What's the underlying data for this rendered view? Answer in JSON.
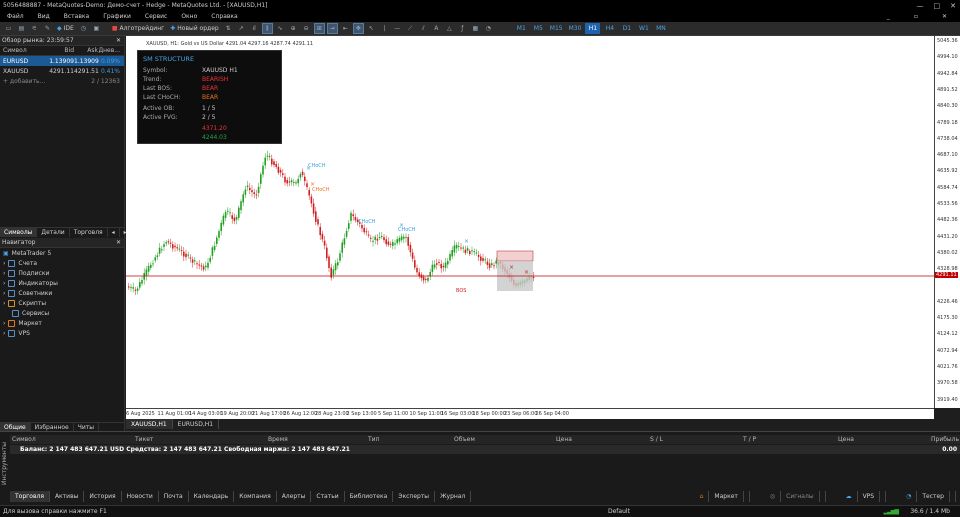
{
  "titlebar": {
    "text": "5056488887 - MetaQuotes-Demo: Демо-счет - Hedge - MetaQuotes Ltd. - [XAUUSD,H1]",
    "min": "—",
    "max": "□",
    "close": "✕"
  },
  "menu": [
    "Файл",
    "Вид",
    "Вставка",
    "Графики",
    "Сервис",
    "Окно",
    "Справка"
  ],
  "menu_right": [
    "_",
    "▫",
    "✕"
  ],
  "toolbar": {
    "ide": "IDE",
    "algo": "Алготрейдинг",
    "order": "Новый ордер",
    "timeframes": [
      "M1",
      "M5",
      "M15",
      "M30",
      "H1",
      "H4",
      "D1",
      "W1",
      "MN"
    ],
    "active_tf": "H1"
  },
  "market_watch": {
    "title": "Обзор рынка: 23:59:57",
    "headers": [
      "Символ",
      "Bid",
      "Ask",
      "Днев..."
    ],
    "rows": [
      {
        "symbol": "EURUSD",
        "bid": "1.13909",
        "ask": "1.13909",
        "chg": "0.09%"
      },
      {
        "symbol": "XAUUSD",
        "bid": "4291.11",
        "ask": "4291.51",
        "chg": "0.41%"
      }
    ],
    "add": "+ добавить...",
    "count": "2 / 12363",
    "tabs": [
      "Символы",
      "Детали",
      "Торговля"
    ]
  },
  "navigator": {
    "title": "Навигатор",
    "root": "MetaTrader 5",
    "items": [
      "Счета",
      "Подписки",
      "Индикаторы",
      "Советники",
      "Скрипты",
      "Сервисы",
      "Маркет",
      "VPS"
    ],
    "tabs": [
      "Общие",
      "Избранное",
      "Читы"
    ]
  },
  "chart": {
    "header": "XAUUSD, H1:  Gold vs US Dollar  4291.04 4297.16 4287.74 4291.11",
    "bg": "#ffffff",
    "bull": "#20a020",
    "bear": "#d02020",
    "labels": {
      "choch": "CHoCH",
      "bos": "BOS"
    }
  },
  "price_axis": [
    "5045.36",
    "4994.10",
    "4942.84",
    "4891.52",
    "4840.30",
    "4789.18",
    "4738.04",
    "4687.10",
    "4635.92",
    "4584.74",
    "4533.56",
    "4482.36",
    "4431.20",
    "4380.02",
    "4328.98",
    "4291.11",
    "4226.46",
    "4175.30",
    "4124.12",
    "4072.94",
    "4021.76",
    "3970.58",
    "3919.40"
  ],
  "current_price": "4291.11",
  "time_axis": [
    "6 Aug 2025",
    "11 Aug 01:00",
    "14 Aug 03:00",
    "19 Aug 20:00",
    "21 Aug 17:00",
    "26 Aug 12:00",
    "28 Aug 23:00",
    "2 Sep 13:00",
    "5 Sep 11:00",
    "10 Sep 11:00",
    "16 Sep 03:00",
    "18 Sep 00:00",
    "23 Sep 06:00",
    "26 Sep 04:00"
  ],
  "info_panel": {
    "title": "SM STRUCTURE",
    "rows": [
      {
        "k": "Symbol:",
        "v": "XAUUSD H1"
      },
      {
        "k": "Trend:",
        "v": "BEARISH"
      },
      {
        "k": "Last BOS:",
        "v": "BEAR"
      },
      {
        "k": "Last CHoCH:",
        "v": "BEAR"
      },
      {
        "k": "Active OB:",
        "v": "1 / 5"
      },
      {
        "k": "Active FVG:",
        "v": "2 / 5"
      }
    ],
    "p1": "4371.20",
    "p2": "4244.03"
  },
  "chart_tabs": [
    "XAUUSD,H1",
    "EURUSD,H1"
  ],
  "toolbox": {
    "side": "Инструменты",
    "headers": [
      "Символ",
      "Тикет",
      "Время",
      "Тип",
      "Объем",
      "Цена",
      "S / L",
      "T / P",
      "Цена",
      "Прибыль"
    ],
    "balance": "Баланс: 2 147 483 647.21 USD  Средства: 2 147 483 647.21  Свободная маржа: 2 147 483 647.21",
    "profit": "0.00",
    "tabs": [
      "Торговля",
      "Активы",
      "История",
      "Новости",
      "Почта",
      "Календарь",
      "Компания",
      "Алерты",
      "Статьи",
      "Библиотека",
      "Эксперты",
      "Журнал"
    ],
    "right": [
      "Маркет",
      "Сигналы",
      "VPS",
      "Тестер"
    ]
  },
  "status": {
    "help": "Для вызова справки нажмите F1",
    "profile": "Default",
    "traffic": "36.6 / 1.4 Mb"
  }
}
